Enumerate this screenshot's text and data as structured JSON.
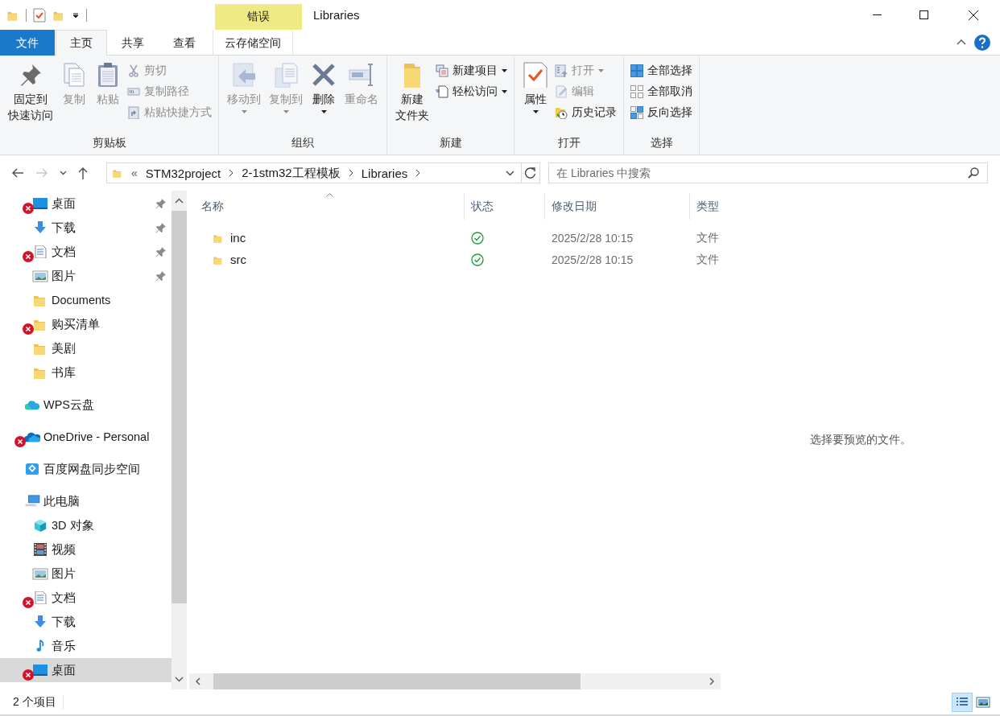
{
  "title_bar": {
    "context_header": "错误",
    "title": "Libraries"
  },
  "ribbon_tabs": [
    {
      "label": "文件",
      "kind": "file",
      "selected": false
    },
    {
      "label": "主页",
      "kind": "normal",
      "selected": true
    },
    {
      "label": "共享",
      "kind": "normal",
      "selected": false
    },
    {
      "label": "查看",
      "kind": "normal",
      "selected": false
    },
    {
      "label": "云存储空间",
      "kind": "context",
      "selected": false
    }
  ],
  "ribbon_groups": [
    {
      "label": "剪贴板",
      "columns": [
        {
          "buttons": [
            {
              "kind": "pin",
              "label": [
                "固定到",
                "快速访问"
              ],
              "disabled": false,
              "dropdown": false
            }
          ]
        },
        {
          "buttons": [
            {
              "kind": "copy",
              "label": [
                "复制"
              ],
              "disabled": true,
              "dropdown": false
            }
          ]
        },
        {
          "buttons": [
            {
              "kind": "paste",
              "label": [
                "粘贴"
              ],
              "disabled": true,
              "dropdown": false
            }
          ]
        },
        {
          "buttons": [
            {
              "kind": "cut",
              "label": [
                "剪切"
              ],
              "disabled": true,
              "dropdown": false
            },
            {
              "kind": "copypath",
              "label": [
                "复制路径"
              ],
              "disabled": true,
              "dropdown": false
            },
            {
              "kind": "pasteshortcut",
              "label": [
                "粘贴快捷方式"
              ],
              "disabled": true,
              "dropdown": false
            }
          ]
        }
      ]
    },
    {
      "label": "组织",
      "columns": [
        {
          "buttons": [
            {
              "kind": "move",
              "label": [
                "移动到"
              ],
              "disabled": true,
              "dropdown": true
            }
          ]
        },
        {
          "buttons": [
            {
              "kind": "copyto",
              "label": [
                "复制到"
              ],
              "disabled": true,
              "dropdown": true
            }
          ]
        },
        {
          "buttons": [
            {
              "kind": "delete",
              "label": [
                "删除"
              ],
              "disabled": false,
              "dropdown": true
            }
          ]
        },
        {
          "buttons": [
            {
              "kind": "rename",
              "label": [
                "重命名"
              ],
              "disabled": true,
              "dropdown": false
            }
          ]
        }
      ]
    },
    {
      "label": "新建",
      "columns": [
        {
          "buttons": [
            {
              "kind": "newfolder",
              "label": [
                "新建",
                "文件夹"
              ],
              "disabled": false,
              "dropdown": false
            }
          ]
        },
        {
          "buttons": [
            {
              "kind": "newitem",
              "label": [
                "新建项目"
              ],
              "disabled": false,
              "dropdown": true
            },
            {
              "kind": "easyaccess",
              "label": [
                "轻松访问"
              ],
              "disabled": false,
              "dropdown": true
            }
          ]
        }
      ]
    },
    {
      "label": "打开",
      "columns": [
        {
          "buttons": [
            {
              "kind": "properties",
              "label": [
                "属性"
              ],
              "disabled": false,
              "dropdown": true
            }
          ]
        },
        {
          "buttons": [
            {
              "kind": "open",
              "label": [
                "打开"
              ],
              "disabled": true,
              "dropdown": true
            },
            {
              "kind": "edit",
              "label": [
                "编辑"
              ],
              "disabled": true,
              "dropdown": false
            },
            {
              "kind": "history",
              "label": [
                "历史记录"
              ],
              "disabled": false,
              "dropdown": false
            }
          ]
        }
      ]
    },
    {
      "label": "选择",
      "columns": [
        {
          "buttons": [
            {
              "kind": "selectall",
              "label": [
                "全部选择"
              ],
              "disabled": false,
              "dropdown": false
            },
            {
              "kind": "selectnone",
              "label": [
                "全部取消"
              ],
              "disabled": false,
              "dropdown": false
            },
            {
              "kind": "invert",
              "label": [
                "反向选择"
              ],
              "disabled": false,
              "dropdown": false
            }
          ]
        }
      ]
    }
  ],
  "address_bar": {
    "overflow": "«",
    "path": [
      "STM32project",
      "2-1stm32工程模板",
      "Libraries"
    ],
    "forward_disabled": true
  },
  "search": {
    "placeholder": "在 Libraries 中搜索"
  },
  "quick_access": [
    {
      "label": "桌面",
      "kind": "desktop",
      "pinned": true,
      "error": true,
      "selected": false
    },
    {
      "label": "下载",
      "kind": "download",
      "pinned": true,
      "error": false,
      "selected": false
    },
    {
      "label": "文档",
      "kind": "document",
      "pinned": true,
      "error": true,
      "selected": false
    },
    {
      "label": "图片",
      "kind": "picture",
      "pinned": true,
      "error": false,
      "selected": false
    },
    {
      "label": "Documents",
      "kind": "folder",
      "pinned": false,
      "error": false,
      "selected": false
    },
    {
      "label": "购买清单",
      "kind": "folder",
      "pinned": false,
      "error": true,
      "selected": false
    },
    {
      "label": "美剧",
      "kind": "folder",
      "pinned": false,
      "error": false,
      "selected": false
    },
    {
      "label": "书库",
      "kind": "folder",
      "pinned": false,
      "error": false,
      "selected": false
    }
  ],
  "locations": [
    {
      "label": "WPS云盘",
      "kind": "wpscloud",
      "error": false,
      "selected": false
    },
    {
      "label": "OneDrive - Personal",
      "kind": "onedrive",
      "error": true,
      "selected": false
    },
    {
      "label": "百度网盘同步空间",
      "kind": "baidu",
      "error": false,
      "selected": false
    },
    {
      "label": "此电脑",
      "kind": "pc",
      "error": false,
      "selected": false,
      "children": [
        {
          "label": "3D 对象",
          "kind": "objects3d",
          "error": false,
          "selected": false
        },
        {
          "label": "视频",
          "kind": "video",
          "error": false,
          "selected": false
        },
        {
          "label": "图片",
          "kind": "picture",
          "error": false,
          "selected": false
        },
        {
          "label": "文档",
          "kind": "document",
          "error": true,
          "selected": false
        },
        {
          "label": "下载",
          "kind": "download",
          "error": false,
          "selected": false
        },
        {
          "label": "音乐",
          "kind": "music",
          "error": false,
          "selected": false
        },
        {
          "label": "桌面",
          "kind": "desktop",
          "error": true,
          "selected": true
        }
      ]
    }
  ],
  "file_list": {
    "columns": [
      {
        "label": "名称",
        "sorted": true
      },
      {
        "label": "状态",
        "sorted": false
      },
      {
        "label": "修改日期",
        "sorted": false
      },
      {
        "label": "类型",
        "sorted": false
      }
    ],
    "rows": [
      {
        "name": "inc",
        "synced": true,
        "modified": "2025/2/28 10:15",
        "type": "文件"
      },
      {
        "name": "src",
        "synced": true,
        "modified": "2025/2/28 10:15",
        "type": "文件"
      }
    ]
  },
  "preview_pane": {
    "message": "选择要预览的文件。"
  },
  "status_bar": {
    "item_count": "2 个项目",
    "views": [
      {
        "kind": "details",
        "selected": true
      },
      {
        "kind": "large_icons",
        "selected": false
      }
    ]
  }
}
